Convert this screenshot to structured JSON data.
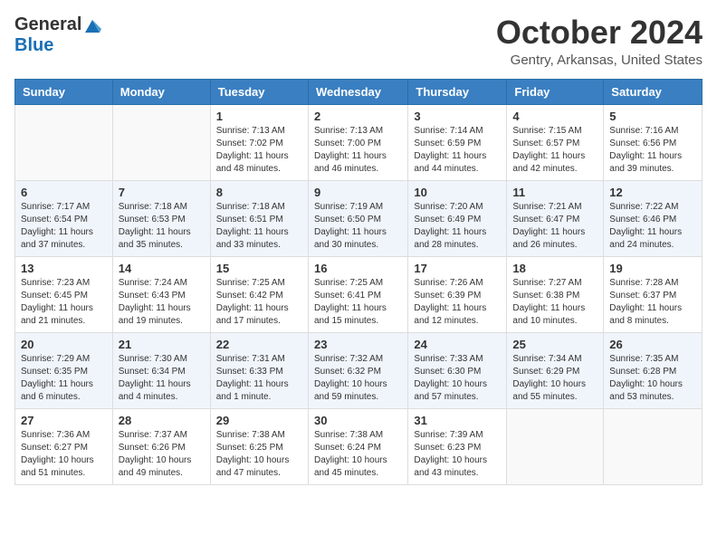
{
  "logo": {
    "general": "General",
    "blue": "Blue"
  },
  "title": "October 2024",
  "location": "Gentry, Arkansas, United States",
  "days_header": [
    "Sunday",
    "Monday",
    "Tuesday",
    "Wednesday",
    "Thursday",
    "Friday",
    "Saturday"
  ],
  "weeks": [
    [
      {
        "day": "",
        "text": ""
      },
      {
        "day": "",
        "text": ""
      },
      {
        "day": "1",
        "text": "Sunrise: 7:13 AM\nSunset: 7:02 PM\nDaylight: 11 hours and 48 minutes."
      },
      {
        "day": "2",
        "text": "Sunrise: 7:13 AM\nSunset: 7:00 PM\nDaylight: 11 hours and 46 minutes."
      },
      {
        "day": "3",
        "text": "Sunrise: 7:14 AM\nSunset: 6:59 PM\nDaylight: 11 hours and 44 minutes."
      },
      {
        "day": "4",
        "text": "Sunrise: 7:15 AM\nSunset: 6:57 PM\nDaylight: 11 hours and 42 minutes."
      },
      {
        "day": "5",
        "text": "Sunrise: 7:16 AM\nSunset: 6:56 PM\nDaylight: 11 hours and 39 minutes."
      }
    ],
    [
      {
        "day": "6",
        "text": "Sunrise: 7:17 AM\nSunset: 6:54 PM\nDaylight: 11 hours and 37 minutes."
      },
      {
        "day": "7",
        "text": "Sunrise: 7:18 AM\nSunset: 6:53 PM\nDaylight: 11 hours and 35 minutes."
      },
      {
        "day": "8",
        "text": "Sunrise: 7:18 AM\nSunset: 6:51 PM\nDaylight: 11 hours and 33 minutes."
      },
      {
        "day": "9",
        "text": "Sunrise: 7:19 AM\nSunset: 6:50 PM\nDaylight: 11 hours and 30 minutes."
      },
      {
        "day": "10",
        "text": "Sunrise: 7:20 AM\nSunset: 6:49 PM\nDaylight: 11 hours and 28 minutes."
      },
      {
        "day": "11",
        "text": "Sunrise: 7:21 AM\nSunset: 6:47 PM\nDaylight: 11 hours and 26 minutes."
      },
      {
        "day": "12",
        "text": "Sunrise: 7:22 AM\nSunset: 6:46 PM\nDaylight: 11 hours and 24 minutes."
      }
    ],
    [
      {
        "day": "13",
        "text": "Sunrise: 7:23 AM\nSunset: 6:45 PM\nDaylight: 11 hours and 21 minutes."
      },
      {
        "day": "14",
        "text": "Sunrise: 7:24 AM\nSunset: 6:43 PM\nDaylight: 11 hours and 19 minutes."
      },
      {
        "day": "15",
        "text": "Sunrise: 7:25 AM\nSunset: 6:42 PM\nDaylight: 11 hours and 17 minutes."
      },
      {
        "day": "16",
        "text": "Sunrise: 7:25 AM\nSunset: 6:41 PM\nDaylight: 11 hours and 15 minutes."
      },
      {
        "day": "17",
        "text": "Sunrise: 7:26 AM\nSunset: 6:39 PM\nDaylight: 11 hours and 12 minutes."
      },
      {
        "day": "18",
        "text": "Sunrise: 7:27 AM\nSunset: 6:38 PM\nDaylight: 11 hours and 10 minutes."
      },
      {
        "day": "19",
        "text": "Sunrise: 7:28 AM\nSunset: 6:37 PM\nDaylight: 11 hours and 8 minutes."
      }
    ],
    [
      {
        "day": "20",
        "text": "Sunrise: 7:29 AM\nSunset: 6:35 PM\nDaylight: 11 hours and 6 minutes."
      },
      {
        "day": "21",
        "text": "Sunrise: 7:30 AM\nSunset: 6:34 PM\nDaylight: 11 hours and 4 minutes."
      },
      {
        "day": "22",
        "text": "Sunrise: 7:31 AM\nSunset: 6:33 PM\nDaylight: 11 hours and 1 minute."
      },
      {
        "day": "23",
        "text": "Sunrise: 7:32 AM\nSunset: 6:32 PM\nDaylight: 10 hours and 59 minutes."
      },
      {
        "day": "24",
        "text": "Sunrise: 7:33 AM\nSunset: 6:30 PM\nDaylight: 10 hours and 57 minutes."
      },
      {
        "day": "25",
        "text": "Sunrise: 7:34 AM\nSunset: 6:29 PM\nDaylight: 10 hours and 55 minutes."
      },
      {
        "day": "26",
        "text": "Sunrise: 7:35 AM\nSunset: 6:28 PM\nDaylight: 10 hours and 53 minutes."
      }
    ],
    [
      {
        "day": "27",
        "text": "Sunrise: 7:36 AM\nSunset: 6:27 PM\nDaylight: 10 hours and 51 minutes."
      },
      {
        "day": "28",
        "text": "Sunrise: 7:37 AM\nSunset: 6:26 PM\nDaylight: 10 hours and 49 minutes."
      },
      {
        "day": "29",
        "text": "Sunrise: 7:38 AM\nSunset: 6:25 PM\nDaylight: 10 hours and 47 minutes."
      },
      {
        "day": "30",
        "text": "Sunrise: 7:38 AM\nSunset: 6:24 PM\nDaylight: 10 hours and 45 minutes."
      },
      {
        "day": "31",
        "text": "Sunrise: 7:39 AM\nSunset: 6:23 PM\nDaylight: 10 hours and 43 minutes."
      },
      {
        "day": "",
        "text": ""
      },
      {
        "day": "",
        "text": ""
      }
    ]
  ]
}
